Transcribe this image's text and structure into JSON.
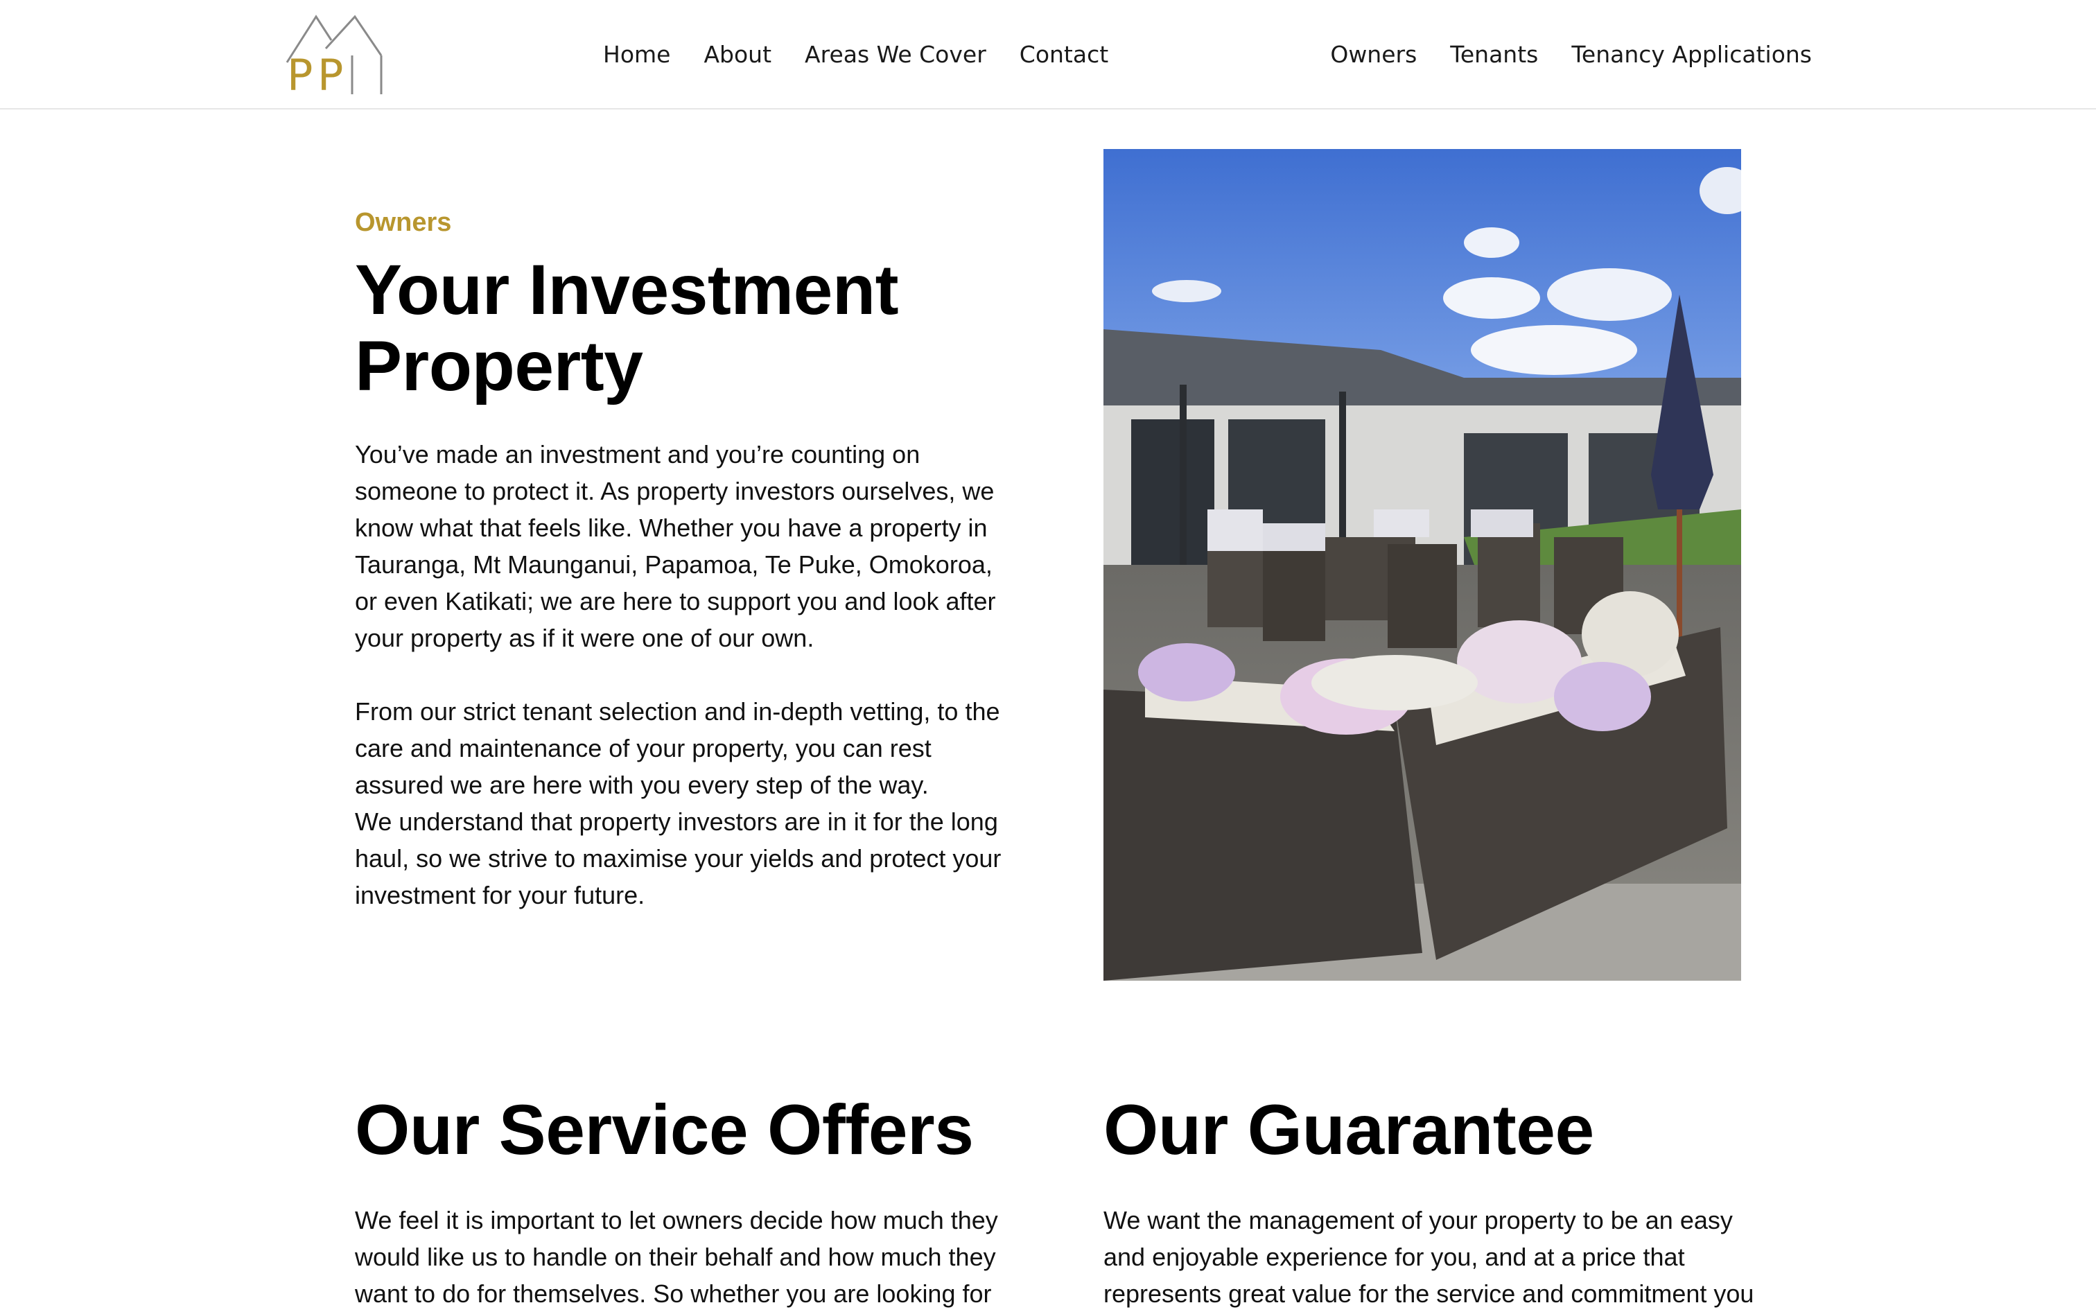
{
  "brand": {
    "logo_text": "PPM"
  },
  "nav": {
    "left": [
      "Home",
      "About",
      "Areas We Cover",
      "Contact"
    ],
    "right": [
      "Owners",
      "Tenants",
      "Tenancy Applications"
    ]
  },
  "hero": {
    "eyebrow": "Owners",
    "title_line1": "Your Investment",
    "title_line2": "Property",
    "paragraphs": [
      "You’ve made an investment and you’re counting on someone to protect it. As property investors ourselves, we know what that feels like. Whether you have a property in Tauranga, Mt Maunganui, Papamoa, Te Puke, Omokoroa, or even Katikati; we are here to support you and look after your property as if it were one of our own.",
      "From our strict tenant selection and in-depth vetting, to the care and maintenance of your property, you can rest assured we are here with you every step of the way.",
      "We understand that property investors are in it for the long haul, so we strive to maximise your yields and protect your investment for your future."
    ],
    "image_alt": "Outdoor patio with wicker lounge and dining set beside a house"
  },
  "services": {
    "title": "Our Service Offers",
    "text": "We feel it is important to let owners decide how much they would like us to handle on their behalf and how much they want to do for themselves. So whether you are looking for"
  },
  "guarantee": {
    "title": "Our Guarantee",
    "text": "We want the management of your property to be an easy and enjoyable experience for you, and at a price that represents great value for the service and commitment you"
  },
  "colors": {
    "accent": "#b8962e",
    "text": "#111111",
    "divider": "#e6e6e6"
  }
}
